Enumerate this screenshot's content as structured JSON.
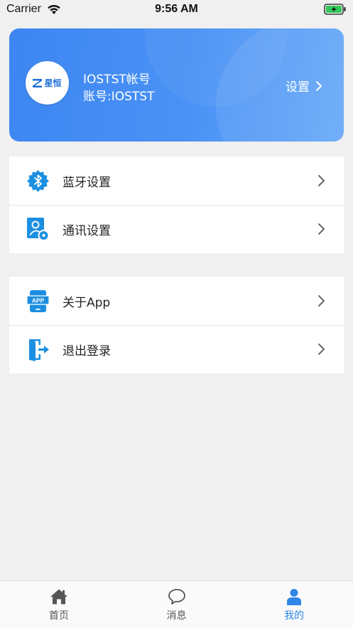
{
  "status_bar": {
    "carrier": "Carrier",
    "time": "9:56 AM",
    "icons": [
      "wifi-icon",
      "battery-charging-icon"
    ]
  },
  "profile": {
    "logo_text": "星恒",
    "account_name": "IOSTST帐号",
    "account_id": "账号:IOSTST",
    "settings_label": "设置",
    "card_gradient": [
      "#3d86f2",
      "#66a8f8"
    ]
  },
  "menu": {
    "group1": [
      {
        "label": "蓝牙设置",
        "icon": "bluetooth-settings-icon"
      },
      {
        "label": "通讯设置",
        "icon": "user-settings-icon"
      }
    ],
    "group2": [
      {
        "label": "关于App",
        "icon": "app-icon"
      },
      {
        "label": "退出登录",
        "icon": "logout-icon"
      }
    ]
  },
  "tabs": [
    {
      "label": "首页",
      "icon": "home-icon",
      "active": false
    },
    {
      "label": "消息",
      "icon": "chat-bubble-icon",
      "active": false
    },
    {
      "label": "我的",
      "icon": "user-icon",
      "active": true
    }
  ],
  "colors": {
    "accent": "#2f86e6",
    "icon_blue": "#1b8fe0",
    "background": "#f0f0f0"
  }
}
